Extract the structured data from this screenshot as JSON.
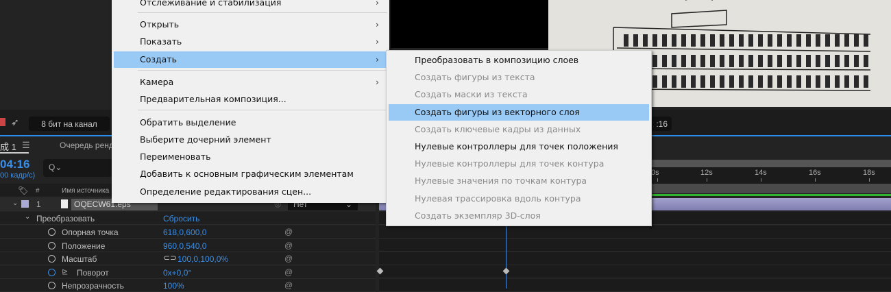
{
  "toolbar": {
    "bit_depth": "8 бит на канал",
    "time_fragment": ":16"
  },
  "panel": {
    "tab_comp": "成 1",
    "tab_menu_icon": "☰",
    "tab_render": "Очередь ренд",
    "timecode": "04:16",
    "fps": "00 кадр/с)",
    "search_placeholder": "Q⌄",
    "col_num": "#",
    "col_source": "Имя источника"
  },
  "layer": {
    "number": "1",
    "name": "OQECW61.eps",
    "parent": "Нет"
  },
  "transform": {
    "label": "Преобразовать",
    "reset": "Сбросить",
    "props": [
      {
        "label": "Опорная точка",
        "value": "618,0,600,0"
      },
      {
        "label": "Положение",
        "value": "960,0,540,0"
      },
      {
        "label": "Масштаб",
        "value": "100,0,100,0%"
      },
      {
        "label": "Поворот",
        "value": "0x+0,0°"
      },
      {
        "label": "Непрозрачность",
        "value": "100%"
      }
    ]
  },
  "timeline": {
    "ticks": [
      "0s",
      "12s",
      "14s",
      "16s",
      "18s"
    ]
  },
  "context_menu": {
    "items": [
      {
        "label": "Отслеживание и стабилизация",
        "submenu": true
      },
      {
        "label": "Открыть",
        "submenu": true
      },
      {
        "label": "Показать",
        "submenu": true
      },
      {
        "label": "Создать",
        "submenu": true,
        "highlighted": true
      },
      {
        "label": "Камера",
        "submenu": true
      },
      {
        "label": "Предварительная композиция..."
      },
      {
        "label": "Обратить выделение"
      },
      {
        "label": "Выберите дочерний элемент"
      },
      {
        "label": "Переименовать"
      },
      {
        "label": "Добавить к основным графическим элементам"
      },
      {
        "label": "Определение редактирования сцен..."
      }
    ]
  },
  "submenu": {
    "items": [
      {
        "label": "Преобразовать в композицию слоев",
        "enabled": true
      },
      {
        "label": "Создать фигуры из текста",
        "enabled": false
      },
      {
        "label": "Создать маски из текста",
        "enabled": false
      },
      {
        "label": "Создать фигуры из векторного слоя",
        "enabled": true,
        "highlighted": true
      },
      {
        "label": "Создать ключевые кадры из данных",
        "enabled": false
      },
      {
        "label": "Нулевые контроллеры для точек положения",
        "enabled": true
      },
      {
        "label": "Нулевые контроллеры для точек контура",
        "enabled": false
      },
      {
        "label": "Нулевые значения по точкам контура",
        "enabled": false
      },
      {
        "label": "Нулевая трассировка вдоль контура",
        "enabled": false
      },
      {
        "label": "Создать экземпляр 3D-слоя",
        "enabled": false
      }
    ]
  },
  "colors": {
    "accent": "#2d8ceb",
    "highlight": "#99c9f5",
    "layer_bar": "#8a88b8",
    "work_area": "#2fb52f"
  }
}
